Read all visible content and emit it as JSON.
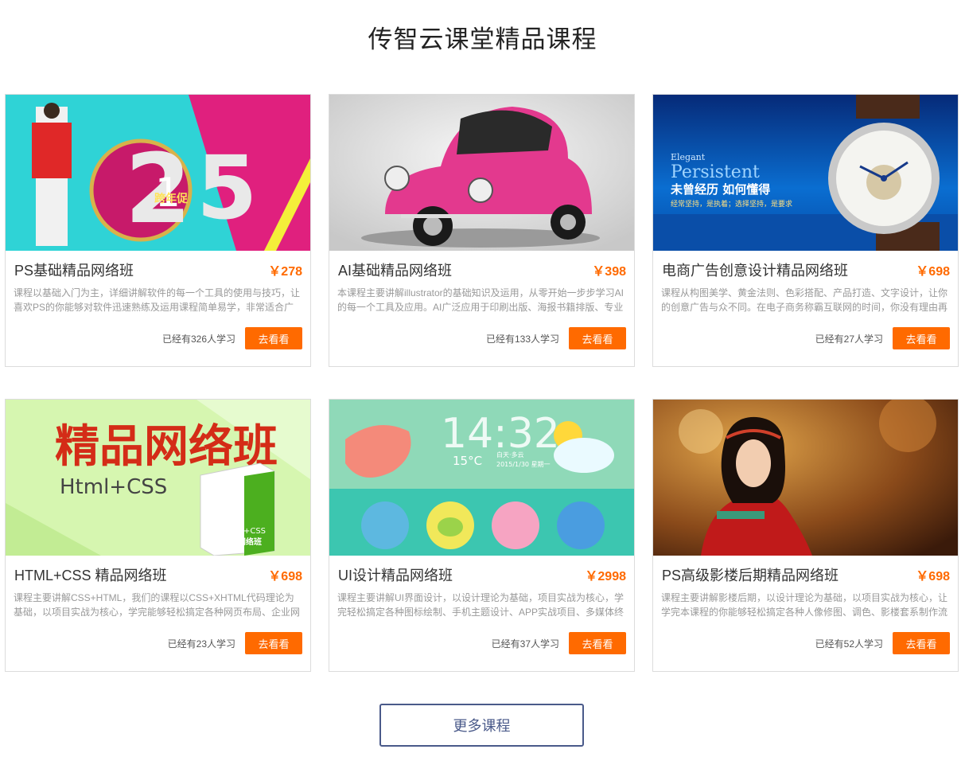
{
  "page": {
    "title": "传智云课堂精品课程",
    "more_label": "更多课程"
  },
  "colors": {
    "accent": "#ff6a00",
    "more_border": "#4a5a8a"
  },
  "courses": [
    {
      "title": "PS基础精品网络班",
      "price": "￥278",
      "desc": "课程以基础入门为主，详细讲解软件的每一个工具的使用与技巧，让喜欢PS的你能够对软件迅速熟练及运用课程简单易学，非常适合广",
      "count": "已经有326人学习",
      "button": "去看看",
      "thumb_text": [
        "跨年促"
      ]
    },
    {
      "title": "AI基础精品网络班",
      "price": "￥398",
      "desc": "本课程主要讲解illustrator的基础知识及运用，从零开始一步步学习AI的每一个工具及应用。AI广泛应用于印刷出版、海报书籍排版、专业",
      "count": "已经有133人学习",
      "button": "去看看",
      "thumb_text": []
    },
    {
      "title": "电商广告创意设计精品网络班",
      "price": "￥698",
      "desc": "课程从构图美学、黄金法则、色彩搭配、产品打造、文字设计，让你的创意广告与众不同。在电子商务称霸互联网的时间，你没有理由再",
      "count": "已经有27人学习",
      "button": "去看看",
      "thumb_text": [
        "Elegant",
        "Persistent",
        "未曾经历 如何懂得",
        "经常坚持，是执着；选择坚持，是要求"
      ]
    },
    {
      "title": "HTML+CSS 精品网络班",
      "price": "￥698",
      "desc": "课程主要讲解CSS+HTML，我们的课程以CSS+XHTML代码理论为基础，以项目实战为核心，学完能够轻松搞定各种网页布局、企业网",
      "count": "已经有23人学习",
      "button": "去看看",
      "thumb_text": [
        "精品网络班",
        "Html+CSS",
        "Html+CSS",
        "精品网络班"
      ]
    },
    {
      "title": "UI设计精品网络班",
      "price": "￥2998",
      "desc": "课程主要讲解UI界面设计，以设计理论为基础，项目实战为核心，学完轻松搞定各种图标绘制、手机主题设计、APP实战项目、多媒体终",
      "count": "已经有37人学习",
      "button": "去看看",
      "thumb_text": [
        "14:32",
        "15°C",
        "白天·多云",
        "2015/1/30 星期一"
      ]
    },
    {
      "title": "PS高级影楼后期精品网络班",
      "price": "￥698",
      "desc": "课程主要讲解影楼后期，以设计理论为基础，以项目实战为核心，让学完本课程的你能够轻松搞定各种人像修图、调色、影楼套系制作流",
      "count": "已经有52人学习",
      "button": "去看看",
      "thumb_text": []
    }
  ]
}
